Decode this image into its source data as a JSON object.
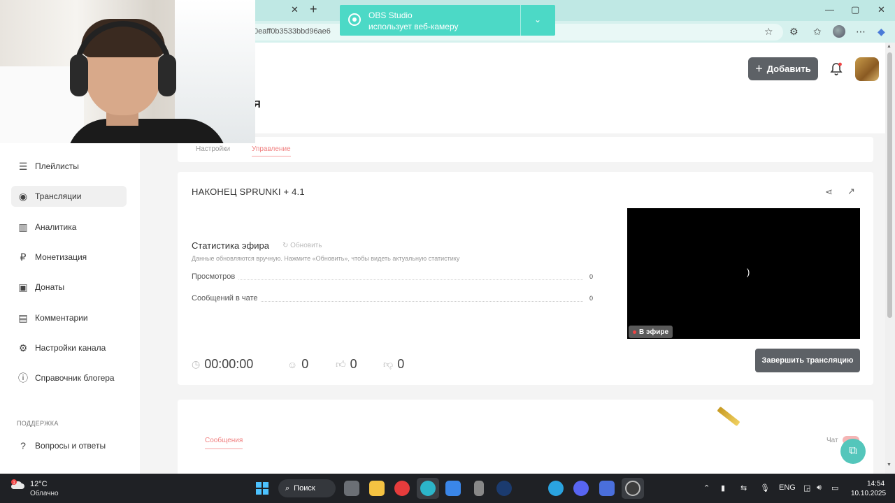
{
  "browser": {
    "url_fragment": "0eaff0b3533bbd96ae6",
    "tab_close": "✕",
    "tab_new": "+"
  },
  "obs_notification": {
    "title": "OBS Studio",
    "subtitle": "использует веб-камеру"
  },
  "header": {
    "title_fragment": "Я",
    "add_button_label": "Добавить"
  },
  "sidebar": {
    "items": [
      {
        "label": "Плейлисты",
        "icon": "playlist-icon"
      },
      {
        "label": "Трансляции",
        "icon": "broadcast-icon"
      },
      {
        "label": "Аналитика",
        "icon": "analytics-icon"
      },
      {
        "label": "Монетизация",
        "icon": "ruble-icon"
      },
      {
        "label": "Донаты",
        "icon": "wallet-icon"
      },
      {
        "label": "Комментарии",
        "icon": "comments-icon"
      },
      {
        "label": "Настройки канала",
        "icon": "gear-icon"
      },
      {
        "label": "Справочник блогера",
        "icon": "info-icon"
      }
    ],
    "support_header": "ПОДДЕРЖКА",
    "support_items": [
      {
        "label": "Вопросы и ответы",
        "icon": "help-icon"
      }
    ]
  },
  "content_tabs": {
    "settings": "Настройки",
    "manage": "Управление"
  },
  "stream": {
    "title": "НАКОНЕЦ SPRUNKI + 4.1",
    "stats_title": "Статистика эфира",
    "refresh_label": "Обновить",
    "stats_note": "Данные обновляются вручную. Нажмите «Обновить», чтобы видеть актуальную статистику",
    "stats": [
      {
        "label": "Просмотров",
        "value": "0"
      },
      {
        "label": "Сообщений в чате",
        "value": "0"
      }
    ],
    "preview_glyph": ")",
    "live_badge": "В эфире",
    "duration": "00:00:00",
    "viewers": "0",
    "likes": "0",
    "dislikes": "0",
    "end_button_label": "Завершить трансляцию"
  },
  "chat": {
    "messages_tab": "Сообщения",
    "chat_label": "Чат"
  },
  "taskbar": {
    "weather_temp": "12°C",
    "weather_desc": "Облачно",
    "weather_badge": "1",
    "search_label": "Поиск",
    "lang": "ENG",
    "time": "14:54",
    "date": "10.10.2025"
  },
  "colors": {
    "accent": "#f08080",
    "button_dark": "#5d6166",
    "obs_teal": "#4cd9c6",
    "browser_tabstrip": "#bfe8e4"
  }
}
